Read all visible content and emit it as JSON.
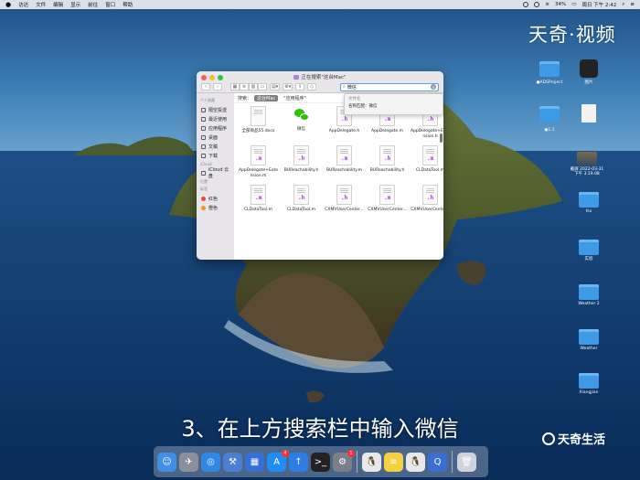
{
  "menubar": {
    "items": [
      "访达",
      "文件",
      "编辑",
      "显示",
      "前往",
      "窗口",
      "帮助"
    ],
    "battery": "34%",
    "clock": "周日 下午 2:42"
  },
  "watermark": "天奇·视频",
  "desktop_icons": [
    {
      "label": "",
      "icon": "folder-icon"
    },
    {
      "label": "",
      "icon": "dark-app-icon"
    },
    {
      "label": "●ADSProject",
      "icon": "folder-icon"
    },
    {
      "label": "图片",
      "icon": "photo-icon"
    },
    {
      "label": "",
      "icon": "folder-icon"
    },
    {
      "label": "",
      "icon": "file-icon"
    },
    {
      "label": "●1.1",
      "icon": "folder-icon"
    },
    {
      "label": "截屏 2022-03-31 下午 3.19.08",
      "icon": "photo-icon"
    },
    {
      "label": "fsx",
      "icon": "folder-icon"
    },
    {
      "label": "实验",
      "icon": "folder-icon"
    },
    {
      "label": "Weather 2",
      "icon": "folder-icon"
    },
    {
      "label": "Weather",
      "icon": "folder-icon"
    },
    {
      "label": "Xiangjian",
      "icon": "folder-icon"
    }
  ],
  "finder": {
    "title": "正在搜索\"这台Mac\"",
    "search": {
      "value": "微信",
      "placeholder": "搜索"
    },
    "suggestions": {
      "header": "文件名",
      "item": "名称匹配：微信"
    },
    "scope": {
      "label": "搜索：",
      "active": "这台Mac",
      "other": "\"应用程序\""
    },
    "sidebar": {
      "sections": [
        {
          "header": "个人收藏",
          "items": [
            "隔空投送",
            "最近使用",
            "应用程序",
            "桌面",
            "文稿",
            "下载"
          ]
        },
        {
          "header": "iCloud",
          "items": [
            "iCloud 云盘"
          ]
        },
        {
          "header": "位置",
          "items": []
        },
        {
          "header": "标签",
          "items": [
            "红色",
            "橙色"
          ]
        }
      ],
      "tag_colors": [
        "#f0453a",
        "#f7931e"
      ]
    },
    "files": [
      {
        "name": "全部商品55.docx",
        "type": "doc",
        "ext": ""
      },
      {
        "name": "微信",
        "type": "wechat",
        "ext": ""
      },
      {
        "name": "AppDelegate.h",
        "type": "doc",
        "ext": ".h"
      },
      {
        "name": "AppDelegate.m",
        "type": "doc",
        "ext": ".m"
      },
      {
        "name": "AppDelegate+Extension.h",
        "type": "doc",
        "ext": ".h"
      },
      {
        "name": "AppDelegate+Extension.m",
        "type": "doc",
        "ext": ".m"
      },
      {
        "name": "BUReachability.h",
        "type": "doc",
        "ext": ".h"
      },
      {
        "name": "BUReachability.m",
        "type": "doc",
        "ext": ".m"
      },
      {
        "name": "BUReachability.h",
        "type": "doc",
        "ext": ".h"
      },
      {
        "name": "CLDataTool.m",
        "type": "doc",
        "ext": ".m"
      },
      {
        "name": "CLDataTool.m",
        "type": "doc",
        "ext": ".m"
      },
      {
        "name": "CLDataTool.m",
        "type": "doc",
        "ext": ".h"
      },
      {
        "name": "CXMVUserCenter...",
        "type": "doc",
        "ext": ".h"
      },
      {
        "name": "CXMVUserCenter...",
        "type": "doc",
        "ext": ".m"
      },
      {
        "name": "CXMVUserCenter...",
        "type": "doc",
        "ext": ".h"
      }
    ]
  },
  "caption": "3、在上方搜索栏中输入微信",
  "brand": "天奇生活",
  "dock": {
    "apps": [
      {
        "name": "finder-icon",
        "color": "#3f8fe6",
        "glyph": "☺"
      },
      {
        "name": "launchpad-icon",
        "color": "#8a8f99",
        "glyph": "✈"
      },
      {
        "name": "safari-icon",
        "color": "#2f87e8",
        "glyph": "◎"
      },
      {
        "name": "xcode-icon",
        "color": "#4a7fd1",
        "glyph": "⚒"
      },
      {
        "name": "files-icon",
        "color": "#3570d6",
        "glyph": "▦"
      },
      {
        "name": "appstore-icon",
        "color": "#1e8ef5",
        "glyph": "A",
        "badge": "4"
      },
      {
        "name": "update-icon",
        "color": "#2b7ee6",
        "glyph": "↑"
      },
      {
        "name": "terminal-icon",
        "color": "#222222",
        "glyph": ">_"
      },
      {
        "name": "settings-icon",
        "color": "#7b7f87",
        "glyph": "⚙",
        "badge": "1"
      },
      {
        "name": "qq-icon",
        "color": "#e8e8e8",
        "glyph": "🐧"
      },
      {
        "name": "notes-icon",
        "color": "#f5d142",
        "glyph": "≡"
      },
      {
        "name": "qq-icon-2",
        "color": "#e8e8e8",
        "glyph": "🐧"
      },
      {
        "name": "quicktime-icon",
        "color": "#3b6ed1",
        "glyph": "Q"
      },
      {
        "name": "trash-icon",
        "color": "#cfd4da",
        "glyph": "🗑"
      }
    ]
  }
}
